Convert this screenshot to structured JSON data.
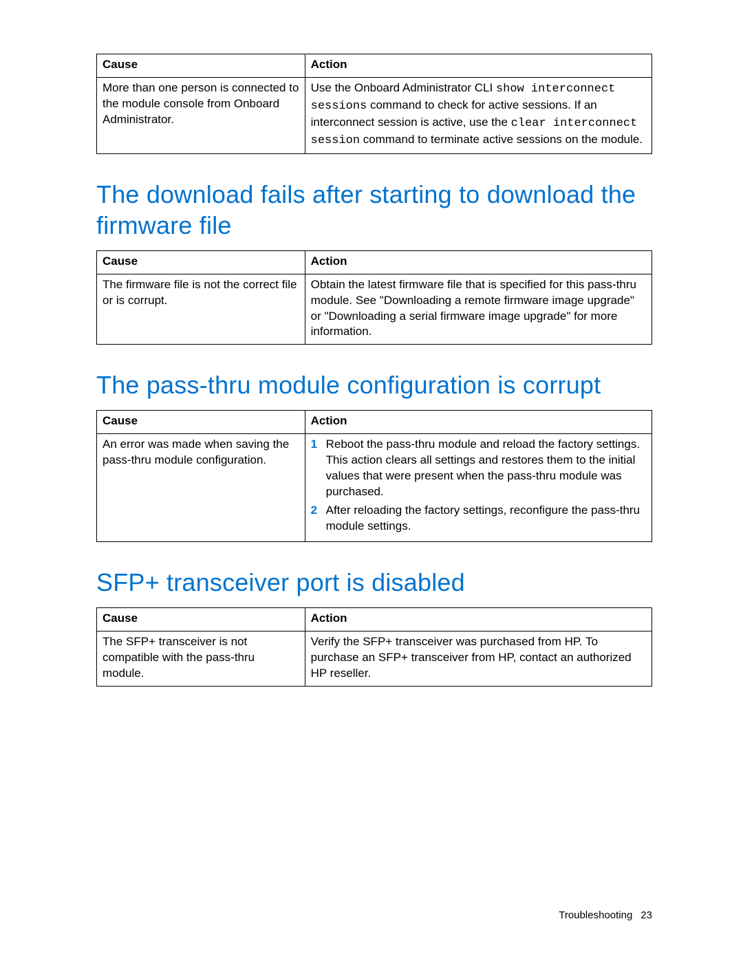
{
  "table1": {
    "headers": {
      "cause": "Cause",
      "action": "Action"
    },
    "row": {
      "cause": "More than one person is connected to the module console from Onboard Administrator.",
      "action_pre": "Use the Onboard Administrator CLI ",
      "code1": "show interconnect sessions",
      "action_mid1": " command to check for active sessions. If an interconnect session is active, use the ",
      "code2": "clear interconnect session",
      "action_post": " command to terminate active sessions on the module."
    }
  },
  "heading1": "The download fails after starting to download the firmware file",
  "table2": {
    "headers": {
      "cause": "Cause",
      "action": "Action"
    },
    "row": {
      "cause": "The firmware file is not the correct file or is corrupt.",
      "action": "Obtain the latest firmware file that is specified for this pass-thru module. See \"Downloading a remote firmware image upgrade\" or \"Downloading a serial firmware image upgrade\" for more information."
    }
  },
  "heading2": "The pass-thru module configuration is corrupt",
  "table3": {
    "headers": {
      "cause": "Cause",
      "action": "Action"
    },
    "row": {
      "cause": "An error was made when saving the pass-thru module configuration.",
      "step1": "Reboot the pass-thru module and reload the factory settings. This action clears all settings and restores them to the initial values that were present when the pass-thru module was purchased.",
      "step2": "After reloading the factory settings, reconfigure the pass-thru module settings."
    }
  },
  "heading3": "SFP+ transceiver port is disabled",
  "table4": {
    "headers": {
      "cause": "Cause",
      "action": "Action"
    },
    "row": {
      "cause": "The SFP+ transceiver is not compatible with the pass-thru module.",
      "action": "Verify the SFP+ transceiver was purchased from HP. To purchase an SFP+ transceiver from HP, contact an authorized HP reseller."
    }
  },
  "footer": {
    "section": "Troubleshooting",
    "page": "23"
  }
}
